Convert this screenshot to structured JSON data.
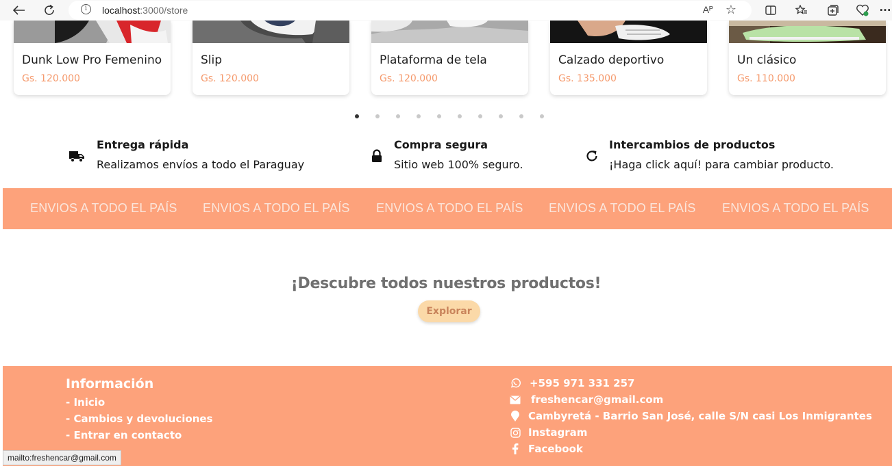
{
  "browser": {
    "url_host": "localhost",
    "url_path": ":3000/store",
    "read_aloud": "Aᴾ"
  },
  "products": [
    {
      "name": "Dunk Low Pro Femenino",
      "price": "Gs. 120.000"
    },
    {
      "name": "Slip",
      "price": "Gs. 120.000"
    },
    {
      "name": "Plataforma de tela",
      "price": "Gs. 120.000"
    },
    {
      "name": "Calzado deportivo",
      "price": "Gs. 135.000"
    },
    {
      "name": "Un clásico",
      "price": "Gs. 110.000"
    }
  ],
  "carousel": {
    "total": 10,
    "active": 1
  },
  "features": [
    {
      "icon": "truck-icon",
      "title": "Entrega rápida",
      "desc": "Realizamos envíos a todo el Paraguay"
    },
    {
      "icon": "lock-icon",
      "title": "Compra segura",
      "desc": "Sitio web 100% seguro."
    },
    {
      "icon": "refresh-icon",
      "title": "Intercambios de productos",
      "desc": "¡Haga click aquí! para cambiar producto."
    }
  ],
  "banner": {
    "text": "ENVIOS A TODO EL PAÍS"
  },
  "discover": {
    "title": "¡Descubre todos nuestros productos!",
    "button": "Explorar"
  },
  "footer": {
    "title": "Información",
    "links": [
      "- Inicio",
      "- Cambios y devoluciones",
      "- Entrar en contacto"
    ],
    "contact": [
      {
        "icon": "whatsapp-icon",
        "text": "+595 971 331 257"
      },
      {
        "icon": "mail-icon",
        "text": "freshencar@gmail.com"
      },
      {
        "icon": "location-icon",
        "text": "Cambyretá - Barrio San José, calle S/N casi Los Inmigrantes"
      },
      {
        "icon": "instagram-icon",
        "text": "Instagram"
      },
      {
        "icon": "facebook-icon",
        "text": "Facebook"
      }
    ]
  },
  "status_bar": "mailto:freshencar@gmail.com",
  "colors": {
    "accent": "#fda27b",
    "price": "#f59a6d",
    "button": "#fbd9a8"
  }
}
